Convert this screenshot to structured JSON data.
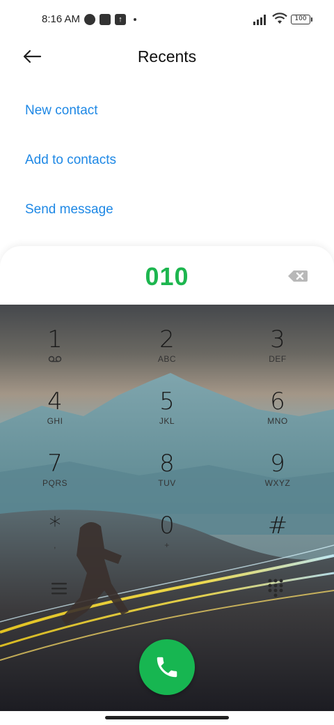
{
  "status_bar": {
    "time": "8:16 AM",
    "battery": "100"
  },
  "header": {
    "title": "Recents"
  },
  "actions": {
    "new_contact": "New contact",
    "add_to_contacts": "Add to contacts",
    "send_message": "Send message"
  },
  "dialer": {
    "number": "010",
    "keys": [
      {
        "digit": "1",
        "letters": "",
        "icon": "voicemail-icon"
      },
      {
        "digit": "2",
        "letters": "ABC"
      },
      {
        "digit": "3",
        "letters": "DEF"
      },
      {
        "digit": "4",
        "letters": "GHI"
      },
      {
        "digit": "5",
        "letters": "JKL"
      },
      {
        "digit": "6",
        "letters": "MNO"
      },
      {
        "digit": "7",
        "letters": "PQRS"
      },
      {
        "digit": "8",
        "letters": "TUV"
      },
      {
        "digit": "9",
        "letters": "WXYZ"
      },
      {
        "digit": "*",
        "letters": ","
      },
      {
        "digit": "0",
        "letters": "+"
      },
      {
        "digit": "#",
        "letters": ""
      }
    ]
  },
  "colors": {
    "accent_blue": "#1e88e5",
    "number_green": "#1db64f",
    "call_green": "#17b651"
  }
}
